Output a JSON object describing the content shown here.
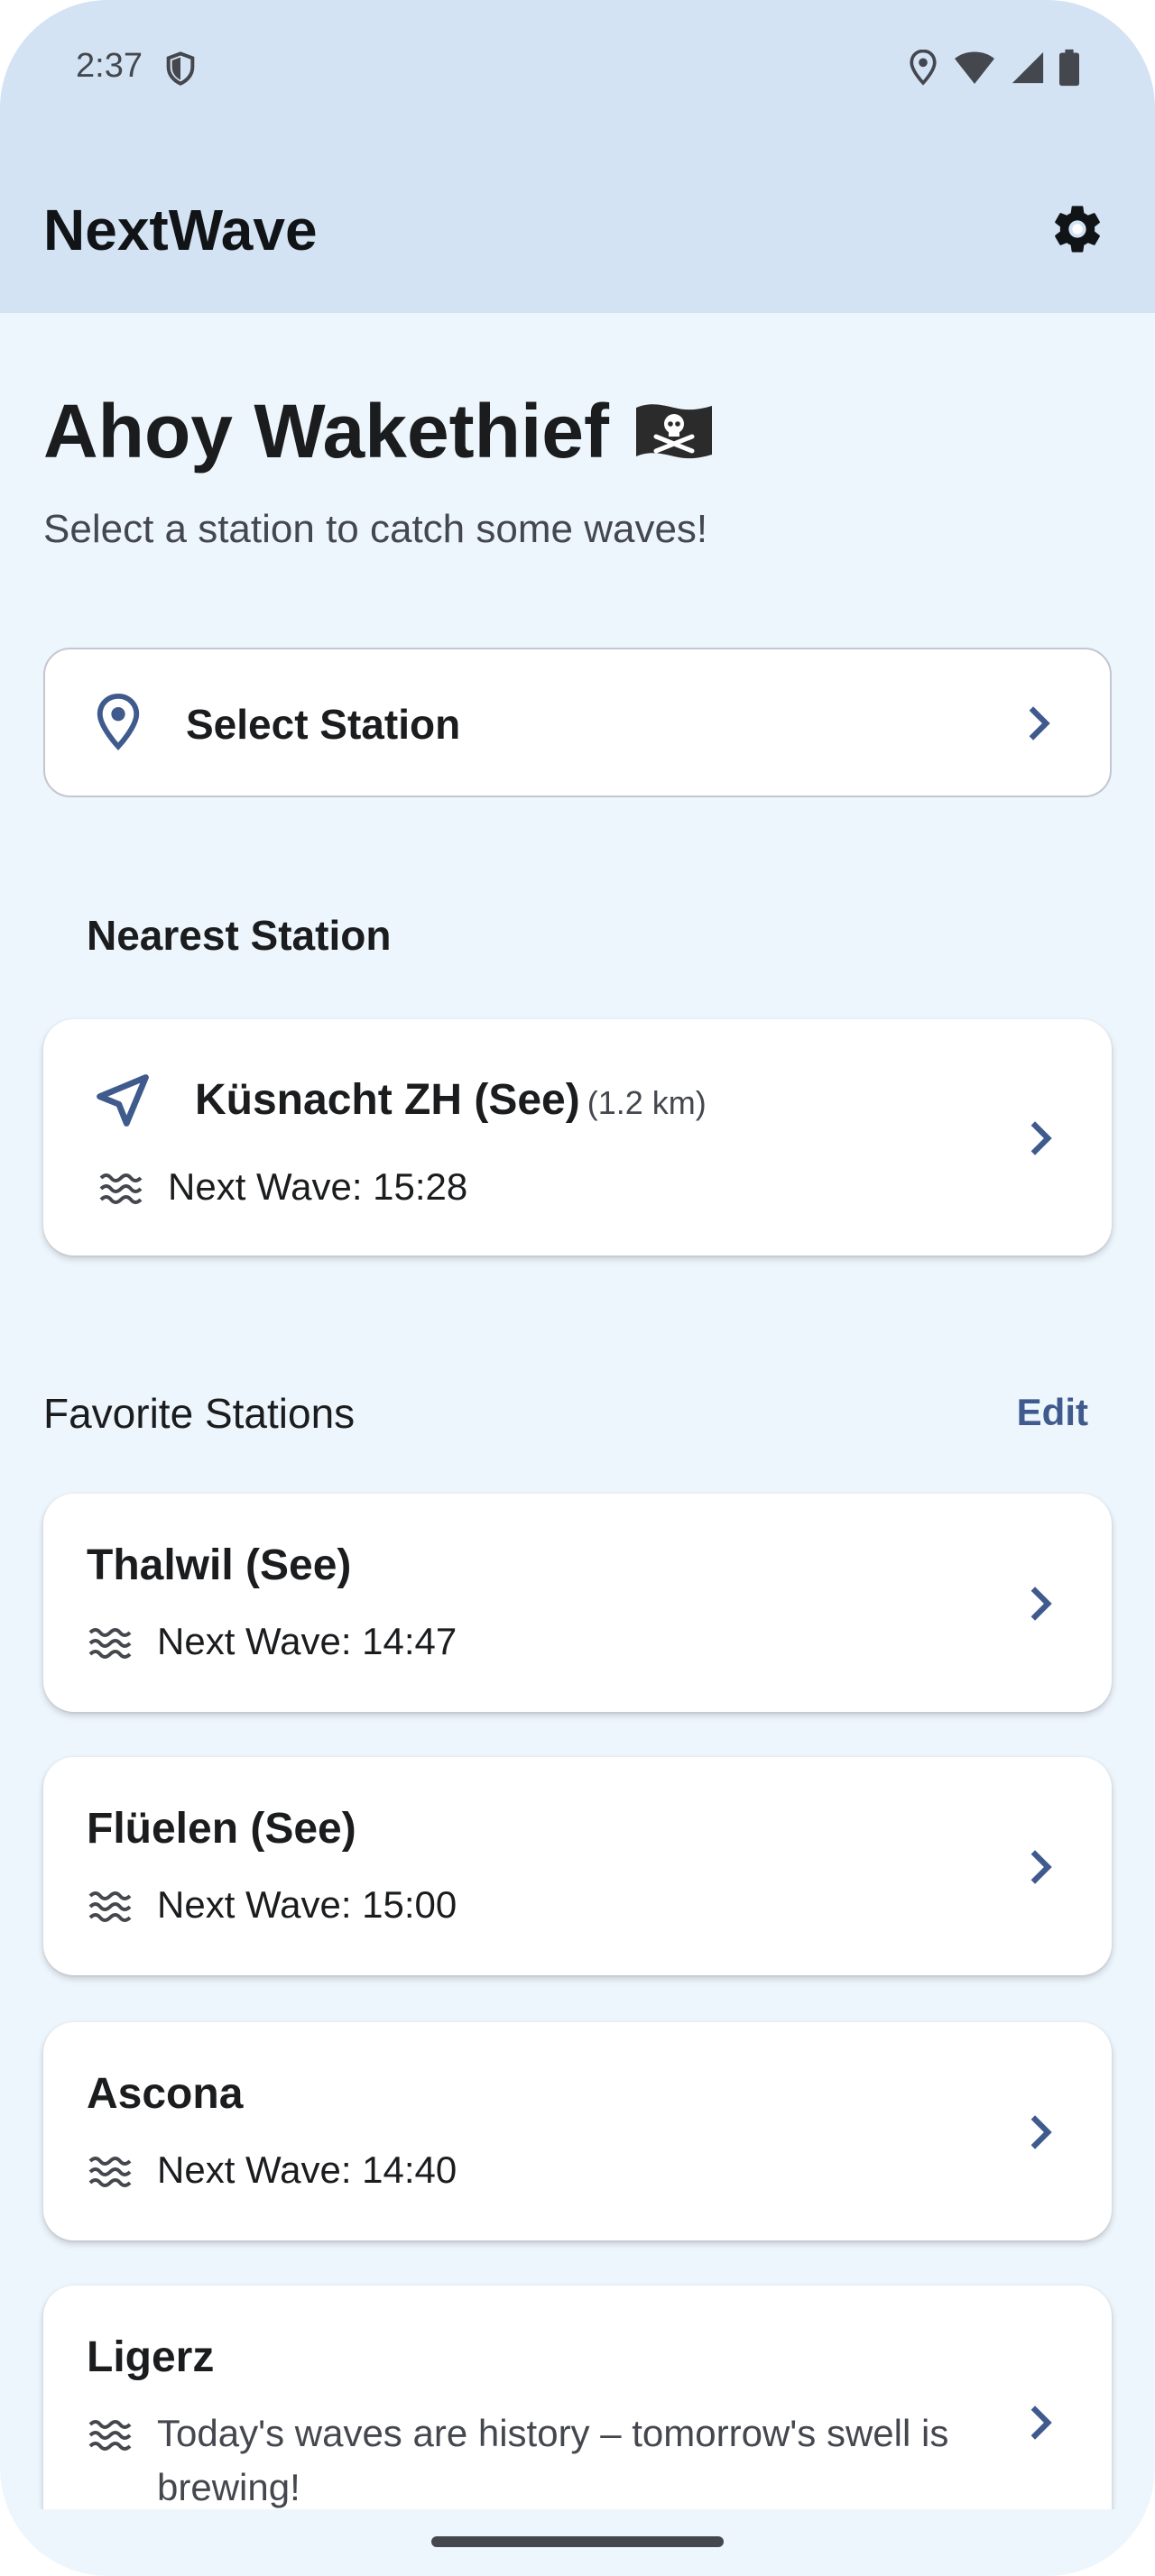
{
  "status_bar": {
    "time": "2:37",
    "icons": [
      "shield-icon",
      "location-icon",
      "wifi-icon",
      "signal-icon",
      "battery-icon"
    ]
  },
  "app_bar": {
    "title": "NextWave",
    "settings_icon": "gear-icon"
  },
  "greeting": {
    "title": "Ahoy Wakethief",
    "flag_icon": "pirate-flag-icon",
    "subtitle": "Select a station to catch some waves!"
  },
  "select_station": {
    "label": "Select Station",
    "icon": "location-pin-icon"
  },
  "nearest": {
    "heading": "Nearest Station",
    "station": {
      "name": "Küsnacht ZH (See)",
      "distance": "(1.2 km)",
      "next_wave": "Next Wave: 15:28"
    }
  },
  "favorites": {
    "heading": "Favorite Stations",
    "edit_label": "Edit",
    "items": [
      {
        "name": "Thalwil (See)",
        "next_wave": "Next Wave: 14:47"
      },
      {
        "name": "Flüelen (See)",
        "next_wave": "Next Wave: 15:00"
      },
      {
        "name": "Ascona",
        "next_wave": "Next Wave: 14:40"
      },
      {
        "name": "Ligerz",
        "next_wave": "Today's waves are history – tomorrow's swell is brewing!"
      }
    ]
  },
  "colors": {
    "app_bar_bg": "#d4e3f3",
    "page_bg": "#eef6fd",
    "accent": "#3f5a8c"
  }
}
